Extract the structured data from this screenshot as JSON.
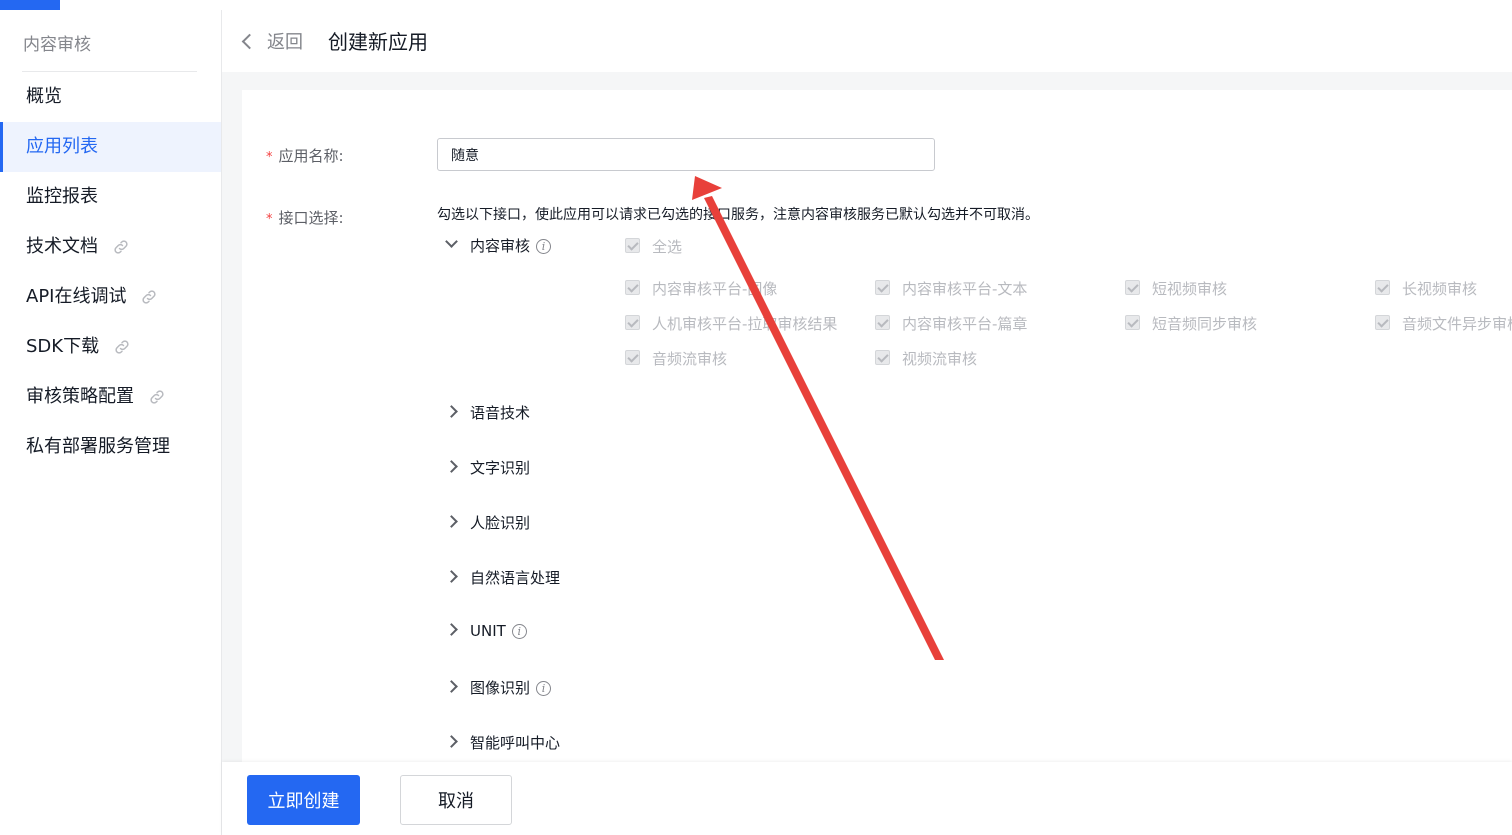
{
  "sidebar": {
    "title": "内容审核",
    "items": [
      {
        "label": "概览",
        "link": false
      },
      {
        "label": "应用列表",
        "link": false
      },
      {
        "label": "监控报表",
        "link": false
      },
      {
        "label": "技术文档",
        "link": true
      },
      {
        "label": "API在线调试",
        "link": true
      },
      {
        "label": "SDK下载",
        "link": true
      },
      {
        "label": "审核策略配置",
        "link": true
      },
      {
        "label": "私有部署服务管理",
        "link": false
      }
    ],
    "active_index": 1
  },
  "header": {
    "back_label": "返回",
    "title": "创建新应用"
  },
  "form": {
    "name_label": "应用名称:",
    "name_value": "随意",
    "interface_label": "接口选择:",
    "interface_hint": "勾选以下接口，使此应用可以请求已勾选的接口服务，注意内容审核服务已默认勾选并不可取消。",
    "groups": [
      {
        "label": "内容审核",
        "expanded": true,
        "info": true
      },
      {
        "label": "语音技术",
        "expanded": false,
        "info": false
      },
      {
        "label": "文字识别",
        "expanded": false,
        "info": false
      },
      {
        "label": "人脸识别",
        "expanded": false,
        "info": false
      },
      {
        "label": "自然语言处理",
        "expanded": false,
        "info": false
      },
      {
        "label": "UNIT",
        "expanded": false,
        "info": true
      },
      {
        "label": "图像识别",
        "expanded": false,
        "info": true
      },
      {
        "label": "智能呼叫中心",
        "expanded": false,
        "info": false
      }
    ],
    "select_all_label": "全选",
    "content_review_services": [
      "内容审核平台-图像",
      "内容审核平台-文本",
      "短视频审核",
      "长视频审核",
      "人机审核平台-拉取审核结果",
      "内容审核平台-篇章",
      "短音频同步审核",
      "音频文件异步审核",
      "音频流审核",
      "视频流审核"
    ]
  },
  "footer": {
    "create_label": "立即创建",
    "cancel_label": "取消"
  },
  "colors": {
    "primary": "#2468f2",
    "required": "#f33e3e",
    "annotation_arrow": "#e8403a"
  },
  "icons": {
    "doc_link": "link-icon",
    "info": "info-icon",
    "back": "chevron-left-icon"
  }
}
